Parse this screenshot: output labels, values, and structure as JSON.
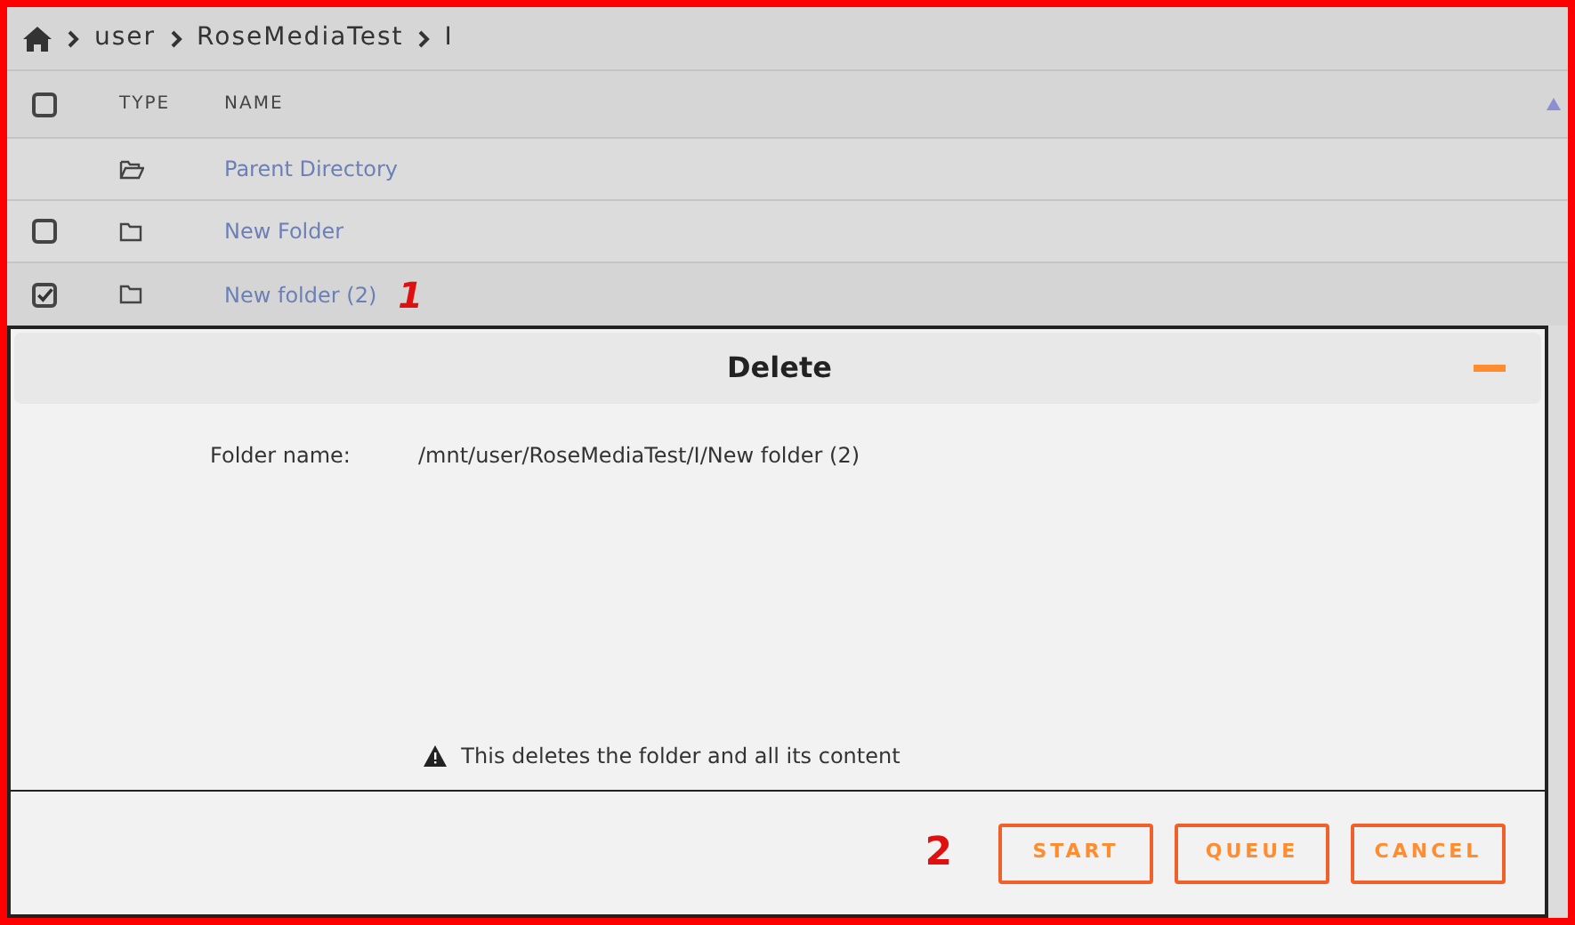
{
  "breadcrumb": [
    "user",
    "RoseMediaTest",
    "I"
  ],
  "table": {
    "columns": [
      "TYPE",
      "NAME"
    ],
    "select_all_checked": false,
    "rows": [
      {
        "kind": "parent",
        "name": "Parent Directory",
        "selected": false
      },
      {
        "kind": "folder",
        "name": "New Folder",
        "checked": false,
        "selected": false
      },
      {
        "kind": "folder",
        "name": "New folder (2)",
        "checked": true,
        "selected": true
      }
    ]
  },
  "dialog": {
    "title": "Delete",
    "field_label": "Folder name:",
    "field_value": "/mnt/user/RoseMediaTest/I/New folder (2)",
    "warning": "This deletes the folder and all its content",
    "buttons": [
      "START",
      "QUEUE",
      "CANCEL"
    ]
  },
  "annotations": [
    "1",
    "2"
  ]
}
